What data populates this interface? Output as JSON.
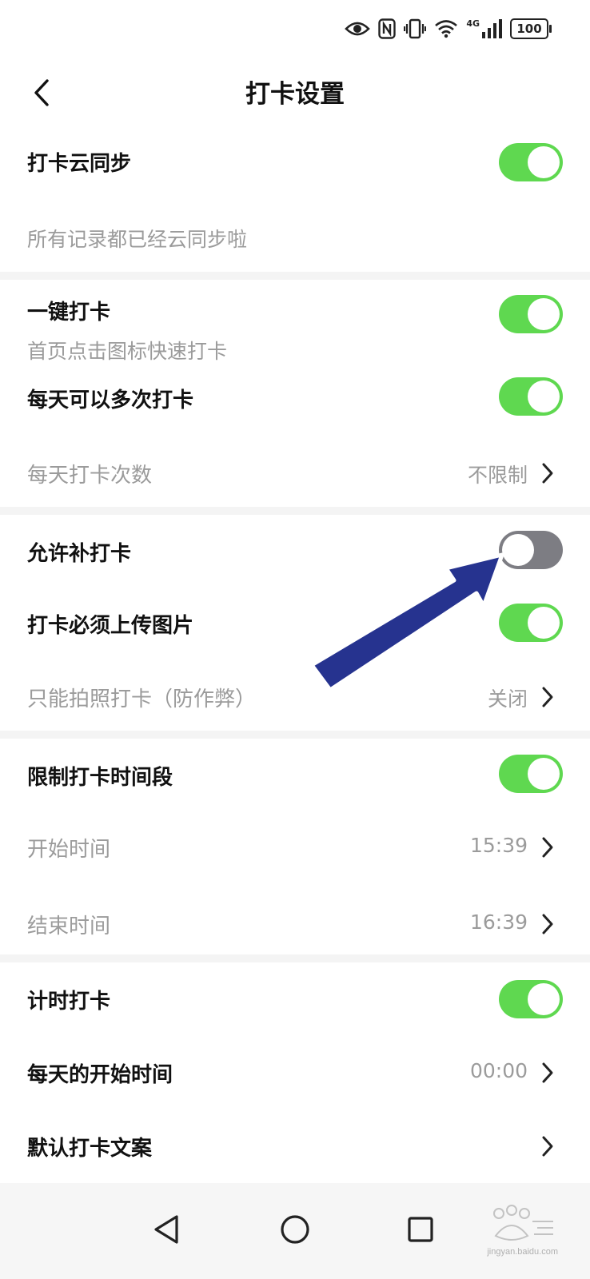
{
  "status_bar": {
    "network_label": "4G",
    "battery_level": "100",
    "icons": [
      "eye-icon",
      "nfc-icon",
      "vibrate-icon",
      "wifi-icon",
      "signal-icon",
      "battery-icon"
    ]
  },
  "header": {
    "title": "打卡设置",
    "back_icon": "chevron-left-icon"
  },
  "sections": {
    "cloud_sync": {
      "label": "打卡云同步",
      "enabled": true,
      "note": "所有记录都已经云同步啦"
    },
    "one_tap": {
      "label": "一键打卡",
      "description": "首页点击图标快速打卡",
      "enabled": true
    },
    "multi_per_day": {
      "label": "每天可以多次打卡",
      "enabled": true
    },
    "daily_count": {
      "label": "每天打卡次数",
      "value": "不限制"
    },
    "allow_makeup": {
      "label": "允许补打卡",
      "enabled": false
    },
    "require_photo": {
      "label": "打卡必须上传图片",
      "enabled": true
    },
    "camera_only": {
      "label": "只能拍照打卡（防作弊）",
      "value": "关闭"
    },
    "limit_time": {
      "label": "限制打卡时间段",
      "enabled": true
    },
    "start_time": {
      "label": "开始时间",
      "value": "15:39"
    },
    "end_time": {
      "label": "结束时间",
      "value": "16:39"
    },
    "timed_checkin": {
      "label": "计时打卡",
      "enabled": true
    },
    "daily_start_time": {
      "label": "每天的开始时间",
      "value": "00:00"
    },
    "default_text": {
      "label": "默认打卡文案",
      "value": ""
    }
  },
  "nav_bar": {
    "icons": [
      "back-triangle-icon",
      "home-circle-icon",
      "recents-square-icon"
    ]
  },
  "watermark": {
    "text": "jingyan.baidu.com"
  },
  "colors": {
    "toggle_on": "#5fd850",
    "toggle_off": "#7d7d83",
    "annotation_arrow": "#26338f",
    "muted_text": "#9b9b9b"
  }
}
